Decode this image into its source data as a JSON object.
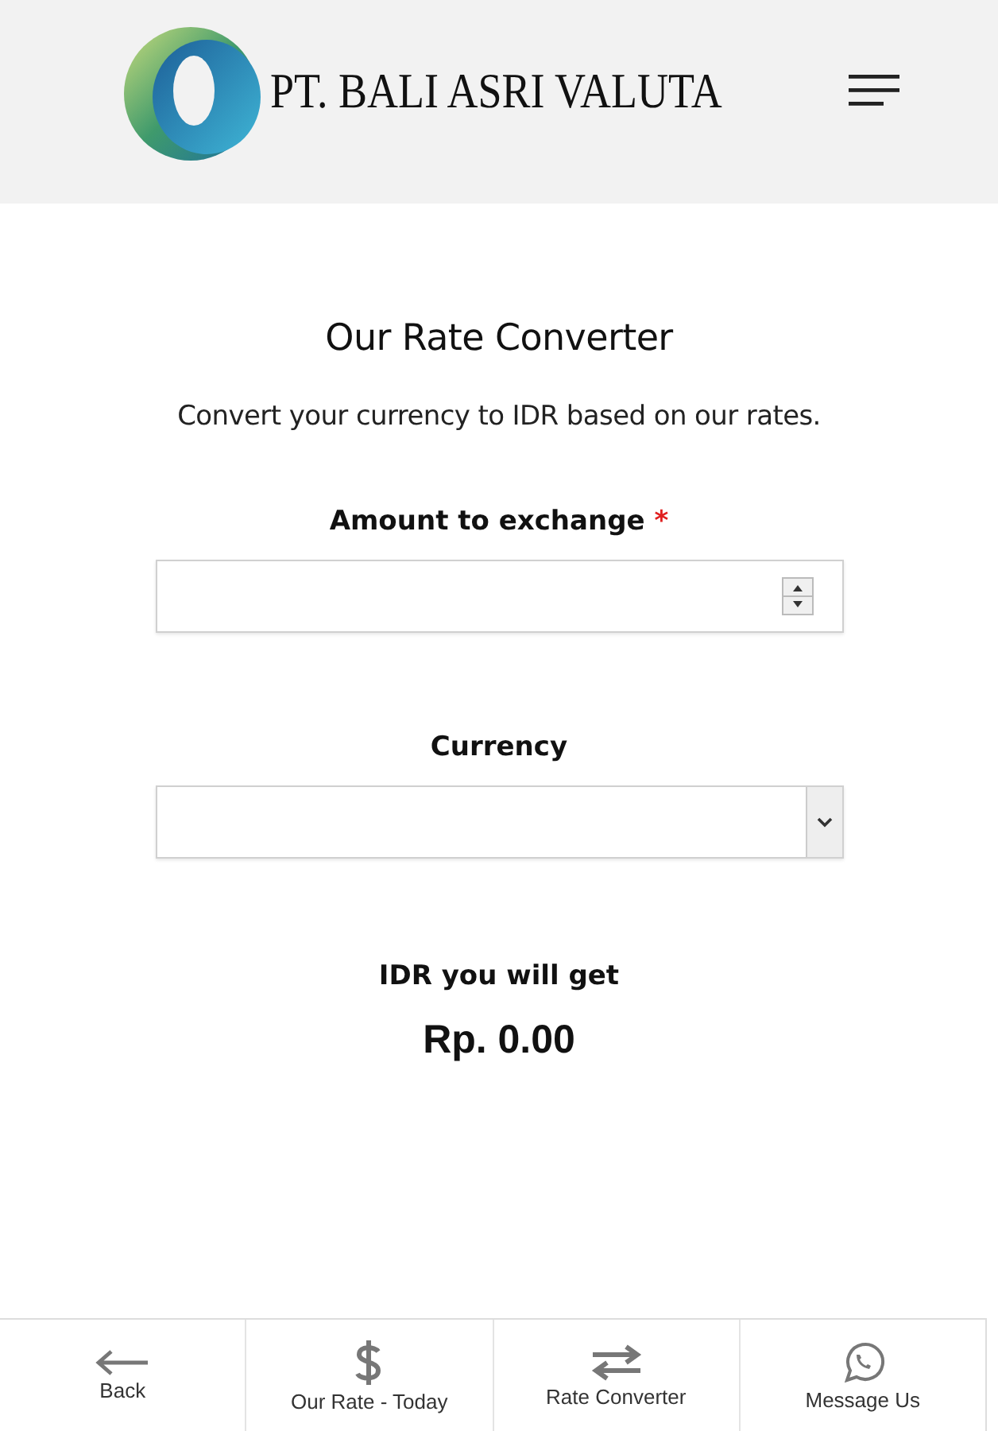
{
  "header": {
    "brand": "PT. BALI ASRI VALUTA"
  },
  "converter": {
    "title": "Our Rate Converter",
    "subtitle": "Convert your currency to IDR based on our rates.",
    "amount": {
      "label": "Amount to exchange",
      "required_mark": "*"
    },
    "currency": {
      "label": "Currency"
    },
    "result": {
      "label": "IDR you will get",
      "value": "Rp. 0.00"
    }
  },
  "bottom_nav": [
    {
      "kind": "back",
      "label": "Back"
    },
    {
      "kind": "dollar",
      "label": "Our Rate - Today"
    },
    {
      "kind": "swap",
      "label": "Rate Converter"
    },
    {
      "kind": "chat",
      "label": "Message Us"
    }
  ]
}
